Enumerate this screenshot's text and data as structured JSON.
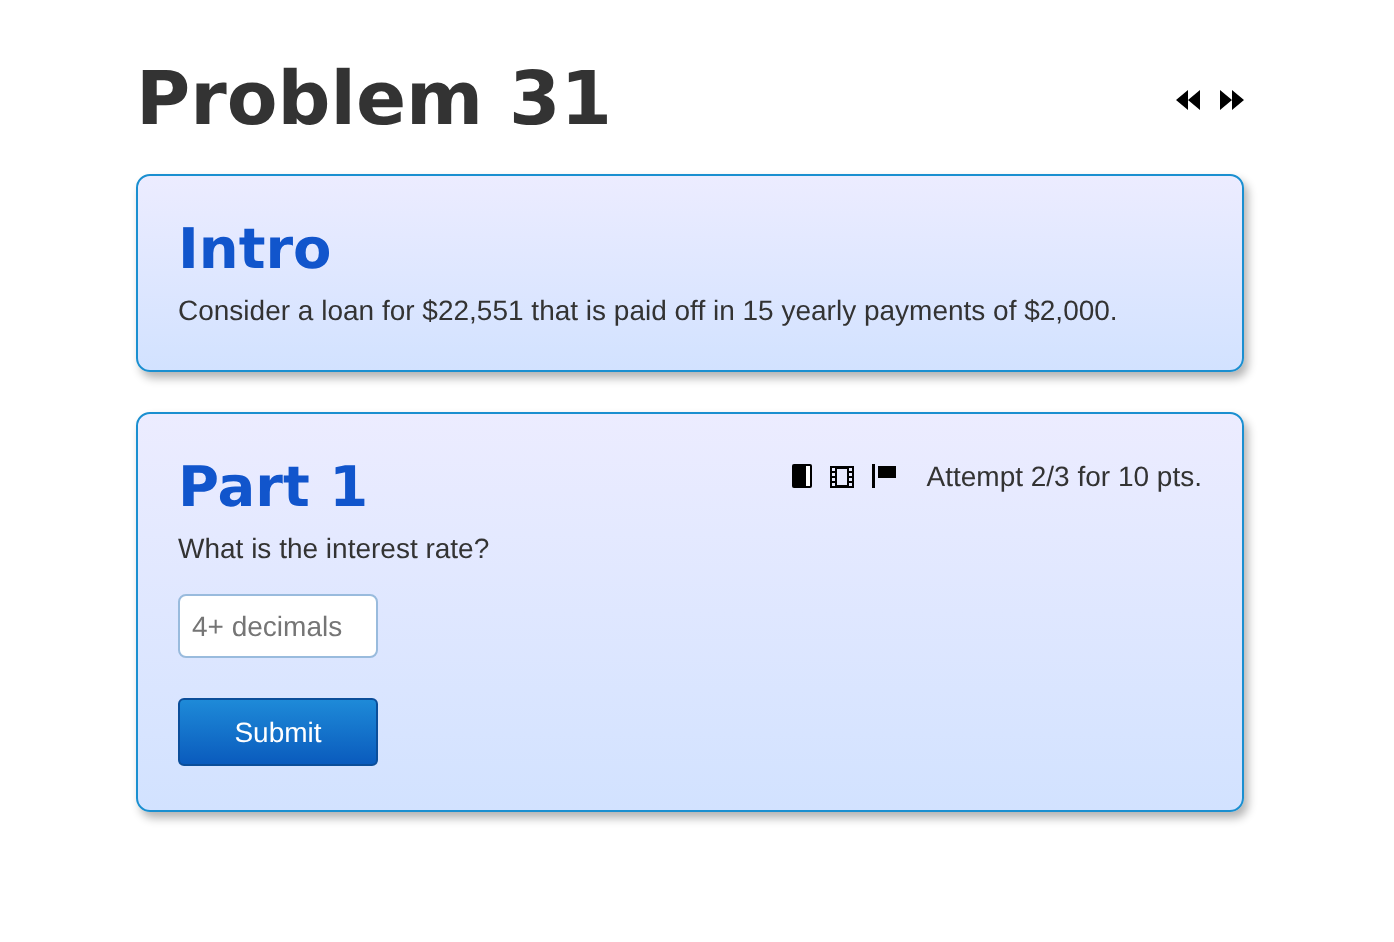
{
  "title": "Problem 31",
  "intro": {
    "heading": "Intro",
    "text": "Consider a loan for $22,551 that is paid off in 15 yearly payments of $2,000."
  },
  "part": {
    "heading": "Part 1",
    "attempt": "Attempt 2/3 for 10 pts.",
    "question": "What is the interest rate?",
    "answer": {
      "placeholder": "4+ decimals"
    },
    "submit": "Submit"
  }
}
